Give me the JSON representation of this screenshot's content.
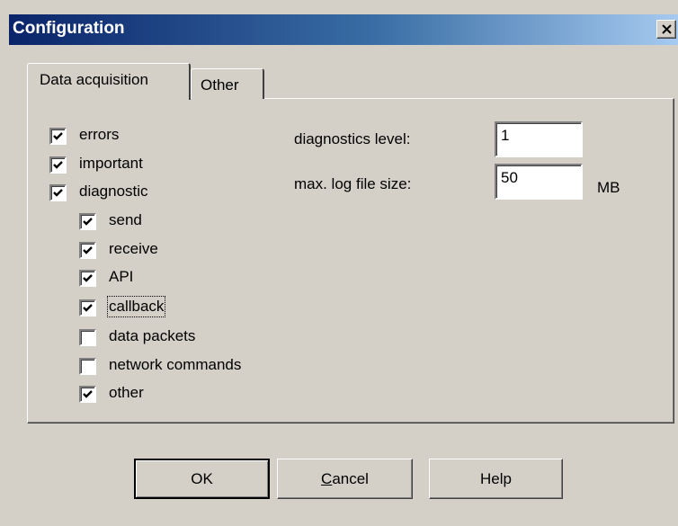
{
  "window": {
    "title": "Configuration"
  },
  "tabs": {
    "active_label": "Data acquisition",
    "other_label": "Other"
  },
  "checkboxes": {
    "errors": {
      "label": "errors",
      "checked": true
    },
    "important": {
      "label": "important",
      "checked": true
    },
    "diagnostic": {
      "label": "diagnostic",
      "checked": true
    },
    "send": {
      "label": "send",
      "checked": true
    },
    "receive": {
      "label": "receive",
      "checked": true
    },
    "api": {
      "label": "API",
      "checked": true
    },
    "callback": {
      "label": "callback",
      "checked": true
    },
    "data_packets": {
      "label": "data packets",
      "checked": false
    },
    "network_commands": {
      "label": "network commands",
      "checked": false
    },
    "other": {
      "label": "other",
      "checked": true
    }
  },
  "fields": {
    "diag_level_label": "diagnostics level:",
    "diag_level_value": "1",
    "log_size_label": "max. log file size:",
    "log_size_value": "50",
    "log_size_unit": "MB"
  },
  "buttons": {
    "ok": "OK",
    "cancel_mnemonic": "C",
    "cancel_rest": "ancel",
    "help": "Help"
  }
}
